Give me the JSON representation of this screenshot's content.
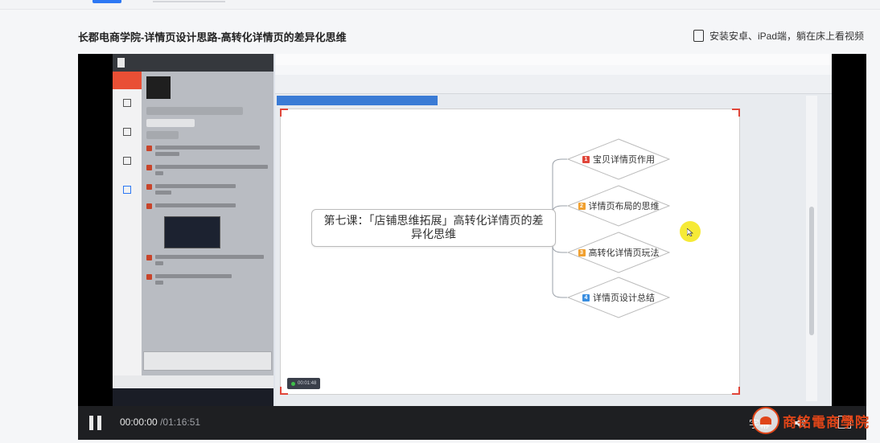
{
  "page": {
    "title": "长郡电商学院-详情页设计思路-高转化详情页的差异化思维",
    "promo": "安装安卓、iPad端，躺在床上看视频"
  },
  "mindmap": {
    "central_topic": "第七课：「店铺思维拓展」高转化详情页的差异化思维",
    "branches": [
      {
        "num": "1",
        "label": "宝贝详情页作用",
        "color": "#e0463a"
      },
      {
        "num": "2",
        "label": "详情页布局的思维",
        "color": "#f0a030"
      },
      {
        "num": "3",
        "label": "高转化详情页玩法",
        "color": "#f0a030"
      },
      {
        "num": "4",
        "label": "详情页设计总结",
        "color": "#3a8ee0"
      }
    ],
    "recording_timer": "00:01:48"
  },
  "player": {
    "current_time": "00:00:00",
    "duration": "/01:16:51",
    "subtitle_label": "字幕"
  },
  "watermark": {
    "text": "商铭電商學院"
  },
  "colors": {
    "accent": "#2d78f4",
    "frame": "#e0463a",
    "watermark": "#e04518"
  }
}
